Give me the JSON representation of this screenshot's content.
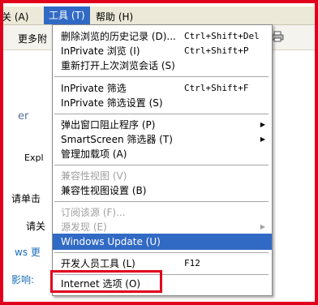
{
  "menubar": {
    "left_fragment": "关 (A)",
    "tools": "工具 (T)",
    "help": "帮助 (H)"
  },
  "toolbar": {
    "more_fragment": "更多附"
  },
  "page": {
    "frag_er": "er",
    "frag_expl": "Expl",
    "frag_please_click": "请单击",
    "frag_please_close": "请关",
    "frag_ws": "ws 更",
    "frag_impact": "影响:"
  },
  "menu": {
    "items": [
      {
        "label": "删除浏览的历史记录 (D)...",
        "shortcut": "Ctrl+Shift+Del"
      },
      {
        "label": "InPrivate 浏览 (I)",
        "shortcut": "Ctrl+Shift+P"
      },
      {
        "label": "重新打开上次浏览会话 (S)",
        "shortcut": ""
      },
      {
        "label": "InPrivate 筛选",
        "shortcut": "Ctrl+Shift+F"
      },
      {
        "label": "InPrivate 筛选设置 (S)",
        "shortcut": ""
      },
      {
        "label": "弹出窗口阻止程序 (P)",
        "shortcut": ""
      },
      {
        "label": "SmartScreen 筛选器 (T)",
        "shortcut": ""
      },
      {
        "label": "管理加载项 (A)",
        "shortcut": ""
      },
      {
        "label": "兼容性视图 (V)",
        "shortcut": ""
      },
      {
        "label": "兼容性视图设置 (B)",
        "shortcut": ""
      },
      {
        "label": "订阅该源 (F)...",
        "shortcut": ""
      },
      {
        "label": "源发现 (E)",
        "shortcut": ""
      },
      {
        "label": "Windows Update (U)",
        "shortcut": ""
      },
      {
        "label": "开发人员工具 (L)",
        "shortcut": "F12"
      },
      {
        "label": "Internet 选项 (O)",
        "shortcut": ""
      }
    ]
  },
  "colors": {
    "highlight": "#316ac5",
    "annotation_red": "#e0001c",
    "disabled_text": "#a0a0a0"
  },
  "icons": [
    "printer-icon",
    "submenu-arrow-icon"
  ]
}
